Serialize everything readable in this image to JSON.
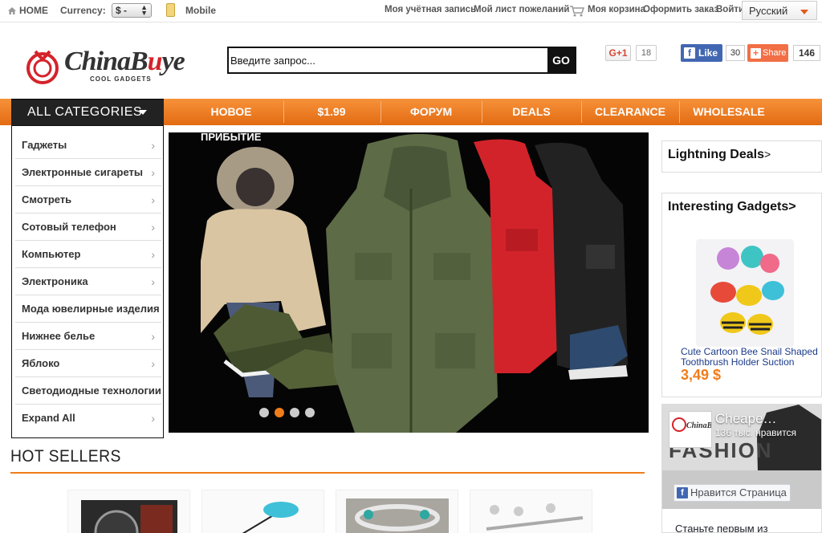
{
  "topbar": {
    "home": "HOME",
    "currency_label": "Currency:",
    "currency_value": "$ -",
    "mobile": "Mobile",
    "my_account": "Моя учётная запись",
    "wishlist": "Мой лист пожеланий",
    "cart": "Моя корзина",
    "checkout": "Оформить заказ",
    "login": "Войти",
    "language": "Русский"
  },
  "header": {
    "logo_text_a": "China",
    "logo_text_b": "B",
    "logo_text_u": "u",
    "logo_text_c": "ye",
    "logo_tagline": "COOL GADGETS",
    "search_placeholder": "Введите запрос...",
    "search_button": "GO"
  },
  "social": {
    "gplus_label": "G+1",
    "gplus_count": "18",
    "fb_like_label": "Like",
    "fb_like_count": "30",
    "share_label": "Share",
    "share_count": "146"
  },
  "nav": {
    "all_categories": "ALL CATEGORIES",
    "items": [
      "НОВОЕ",
      "$1.99",
      "ФОРУМ",
      "DEALS",
      "CLEARANCE",
      "WHOLESALE"
    ]
  },
  "categories": [
    "Гаджеты",
    "Электронные сигареты",
    "Смотреть",
    "Сотовый телефон",
    "Компьютер",
    "Электроника",
    "Мода ювелирные изделия",
    "Нижнее белье",
    "Яблоко",
    "Светодиодные технологии",
    "Expand All"
  ],
  "banner": {
    "label": "ПРИБЫТИЕ",
    "slide_count": 4,
    "active_slide": 2
  },
  "hot_sellers": {
    "title": "HOT SELLERS"
  },
  "right": {
    "lightning_deals": "Lightning Deals",
    "lightning_arrow": ">",
    "interesting_gadgets": "Interesting Gadgets>",
    "gadget_name": "Cute Cartoon Bee Snail Shaped Toothbrush Holder Suction",
    "gadget_price": "3,49 $"
  },
  "fb_widget": {
    "page_name": "Cheape…",
    "likes_text": "136 тыс. нравится",
    "cover_text": "FASHION",
    "like_page": "Нравится Страница",
    "be_first": "Станьте первым из"
  },
  "colors": {
    "accent_orange": "#f07d1a",
    "nav_dark": "#222222",
    "brand_red": "#d4232a",
    "fb_blue": "#4267b2"
  }
}
